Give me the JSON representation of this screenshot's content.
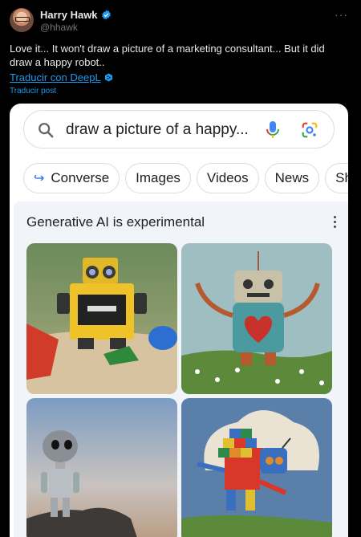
{
  "tweet": {
    "author_name": "Harry Hawk",
    "author_handle": "@hhawk",
    "text": "Love it... It won't draw a picture of a marketing consultant... But it did draw a happy robot..",
    "translate_link": "Traducir con DeepL",
    "translate_post": "Traducir post",
    "more_label": "···"
  },
  "search": {
    "query": "draw a picture of a happy..."
  },
  "chips": [
    "Converse",
    "Images",
    "Videos",
    "News",
    "Sho"
  ],
  "generative": {
    "title": "Generative AI is experimental"
  },
  "images": [
    {
      "icon": "lego-robot-image"
    },
    {
      "icon": "heart-robot-image"
    },
    {
      "icon": "silver-robot-image"
    },
    {
      "icon": "block-robot-image"
    }
  ],
  "colors": {
    "link_blue": "#1d9bf0",
    "google_blue": "#1a73e8",
    "verified_blue": "#1d9bf0"
  }
}
